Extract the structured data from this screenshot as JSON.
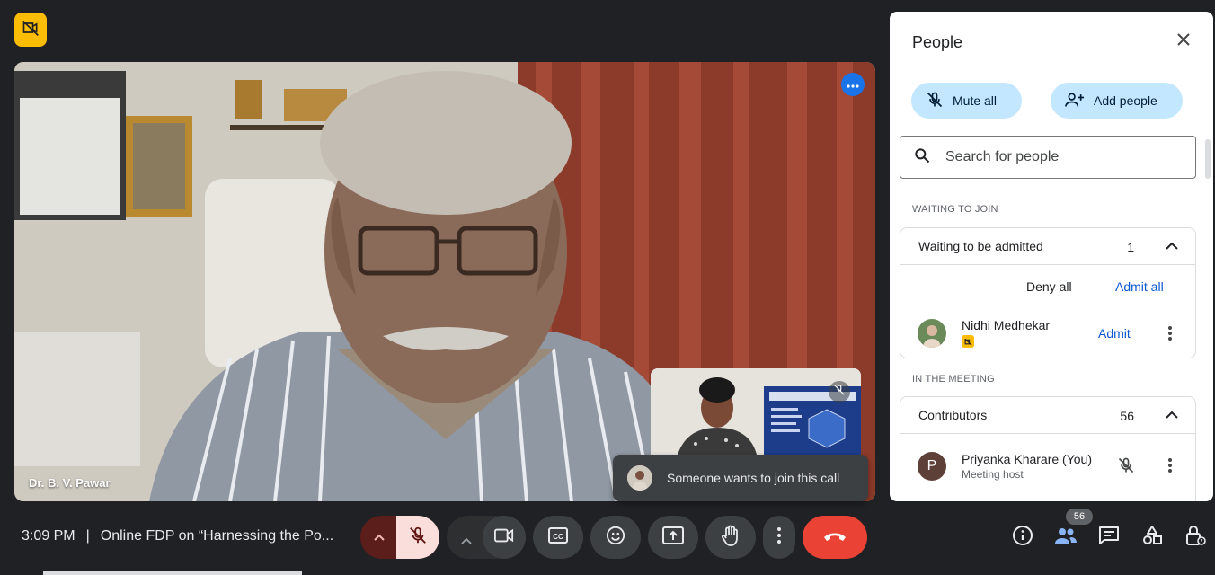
{
  "speaker": {
    "name": "Dr. B. V. Pawar"
  },
  "toast": {
    "text": "Someone wants to join this call"
  },
  "people_panel": {
    "title": "People",
    "mute_all_label": "Mute all",
    "add_people_label": "Add people",
    "search_placeholder": "Search for people",
    "waiting_section_label": "WAITING TO JOIN",
    "waiting_card": {
      "title": "Waiting to be admitted",
      "count": "1",
      "deny_all_label": "Deny all",
      "admit_all_label": "Admit all",
      "person": {
        "name": "Nidhi Medhekar",
        "admit_label": "Admit"
      }
    },
    "meeting_section_label": "IN THE MEETING",
    "contributors_card": {
      "title": "Contributors",
      "count": "56",
      "person": {
        "name": "Priyanka Kharare (You)",
        "role": "Meeting host",
        "initial": "P"
      }
    }
  },
  "bottom_bar": {
    "time": "3:09 PM",
    "separator": "|",
    "meeting_title": "Online FDP on “Harnessing the Po...",
    "participant_count": "56"
  },
  "icons": [
    "video-off-badge-icon",
    "more-options-icon",
    "mic-off-icon",
    "close-icon",
    "add-person-icon",
    "search-icon",
    "chevron-up-icon",
    "kebab-icon",
    "camera-icon",
    "captions-icon",
    "emoji-icon",
    "present-icon",
    "hand-raise-icon",
    "end-call-icon",
    "info-icon",
    "people-icon",
    "chat-icon",
    "activities-icon",
    "host-controls-icon"
  ],
  "colors": {
    "background": "#202124",
    "accent": "#1a73e8",
    "pill": "#c2e7ff",
    "end_call": "#ea4335",
    "mic_off_bg": "#f9dedc",
    "badge": "#fbbc04"
  }
}
